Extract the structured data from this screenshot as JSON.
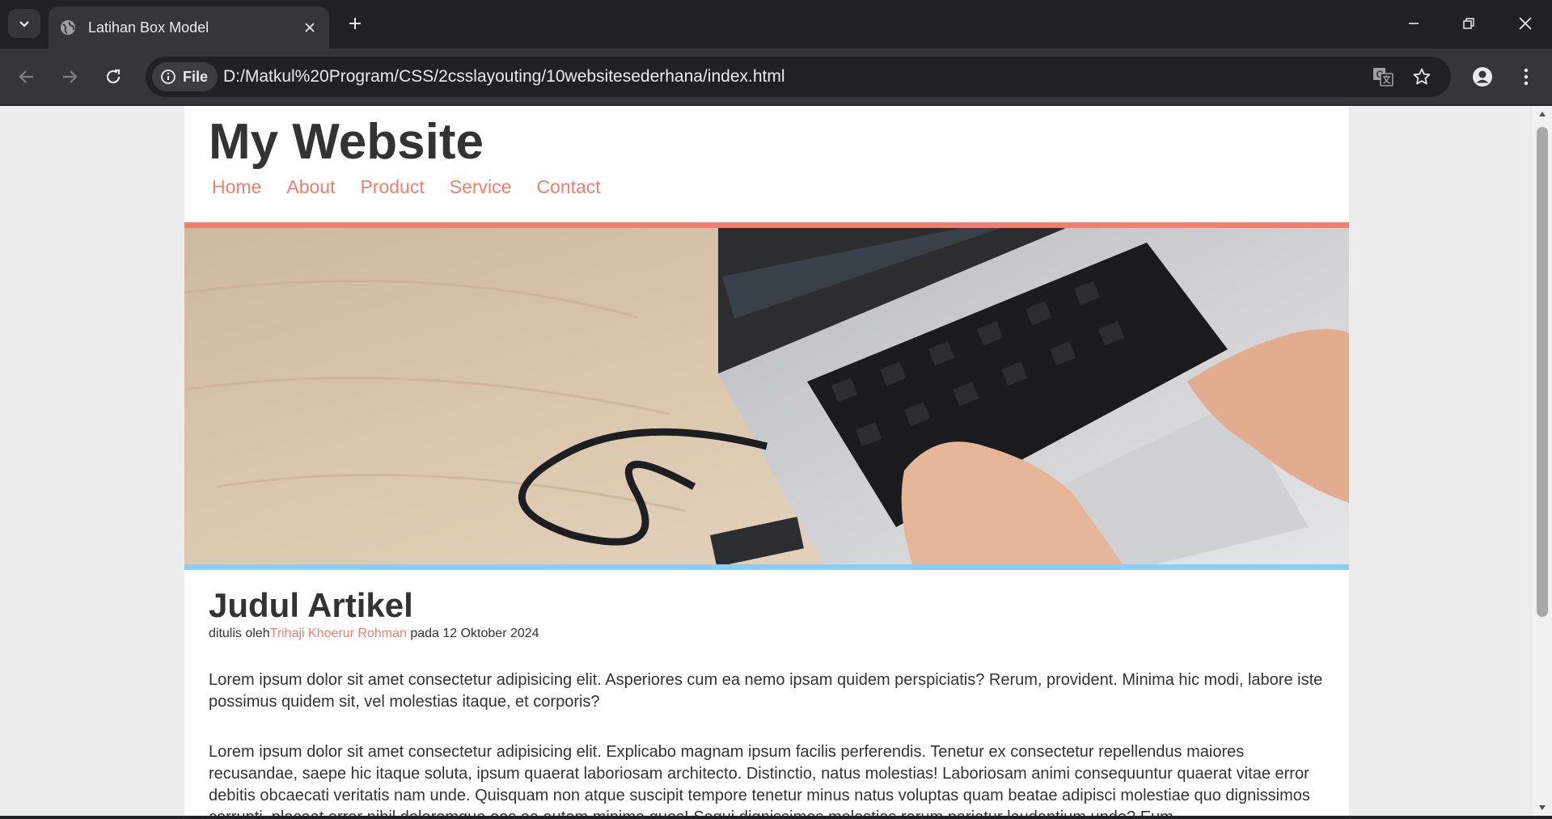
{
  "browser": {
    "tab_title": "Latihan Box Model",
    "site_info_label": "File",
    "url": "D:/Matkul%20Program/CSS/2csslayouting/10websitesederhana/index.html"
  },
  "site": {
    "title": "My Website",
    "menu": [
      "Home",
      "About",
      "Product",
      "Service",
      "Contact"
    ],
    "colors": {
      "accent": "#f47e6f",
      "hero_bottom_border": "#8bcdf3",
      "text": "#333333"
    }
  },
  "article": {
    "title": "Judul Artikel",
    "byline_prefix": "ditulis oleh",
    "author": "Trihaji Khoerur Rohman",
    "byline_suffix": " pada 12 Oktober 2024",
    "paragraphs": [
      "Lorem ipsum dolor sit amet consectetur adipisicing elit. Asperiores cum ea nemo ipsam quidem perspiciatis? Rerum, provident. Minima hic modi, labore iste possimus quidem sit, vel molestias itaque, et corporis?",
      "Lorem ipsum dolor sit amet consectetur adipisicing elit. Explicabo magnam ipsum facilis perferendis. Tenetur ex consectetur repellendus maiores recusandae, saepe hic itaque soluta, ipsum quaerat laboriosam architecto. Distinctio, natus molestias! Laboriosam animi consequuntur quaerat vitae error debitis obcaecati veritatis nam unde. Quisquam non atque suscipit tempore tenetur minus natus voluptas quam beatae adipisci molestiae quo dignissimos corrupti, placeat error nihil doloremque eos ea autem minima quos! Sequi dignissimos molestias rerum pariatur laudantium unde? Eum"
    ]
  }
}
